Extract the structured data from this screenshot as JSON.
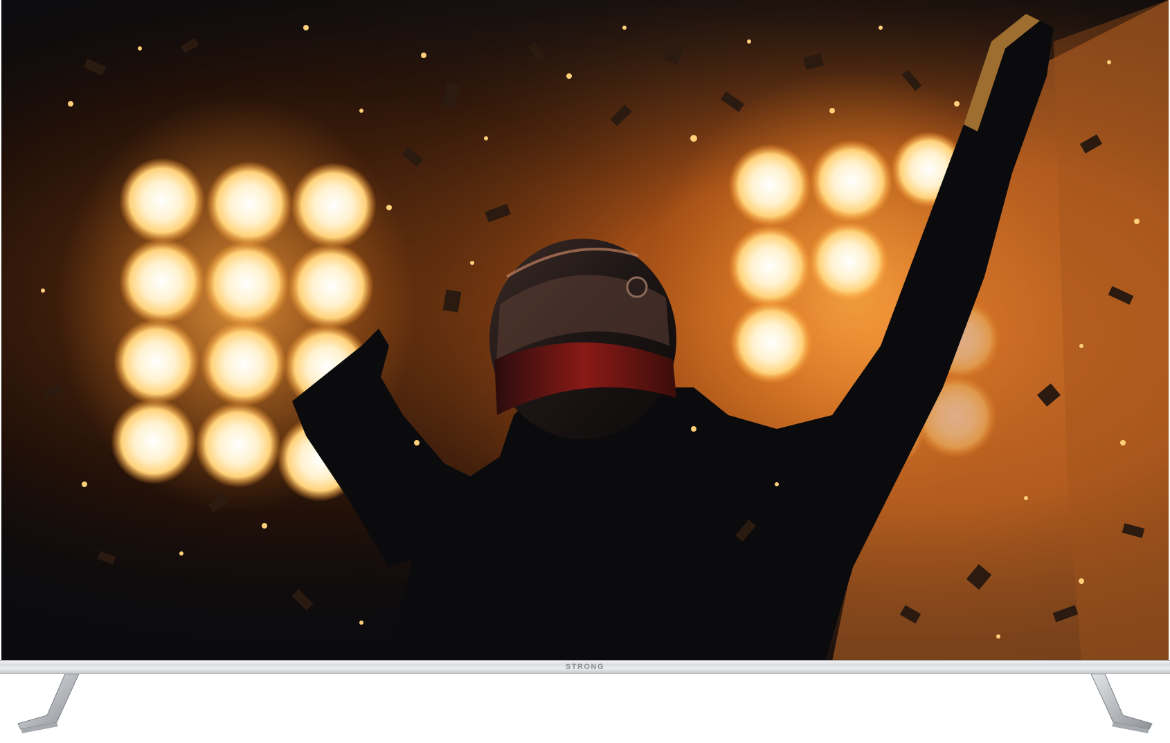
{
  "product": {
    "brand_label": "STRONG"
  },
  "colors": {
    "screen_dark": "#0b0b0e",
    "glow_orange": "#ff9a2a",
    "glow_core": "#fff4d6",
    "frame_silver": "#d9dbdd"
  },
  "icons": {
    "stand": "tv-stand-leg"
  }
}
